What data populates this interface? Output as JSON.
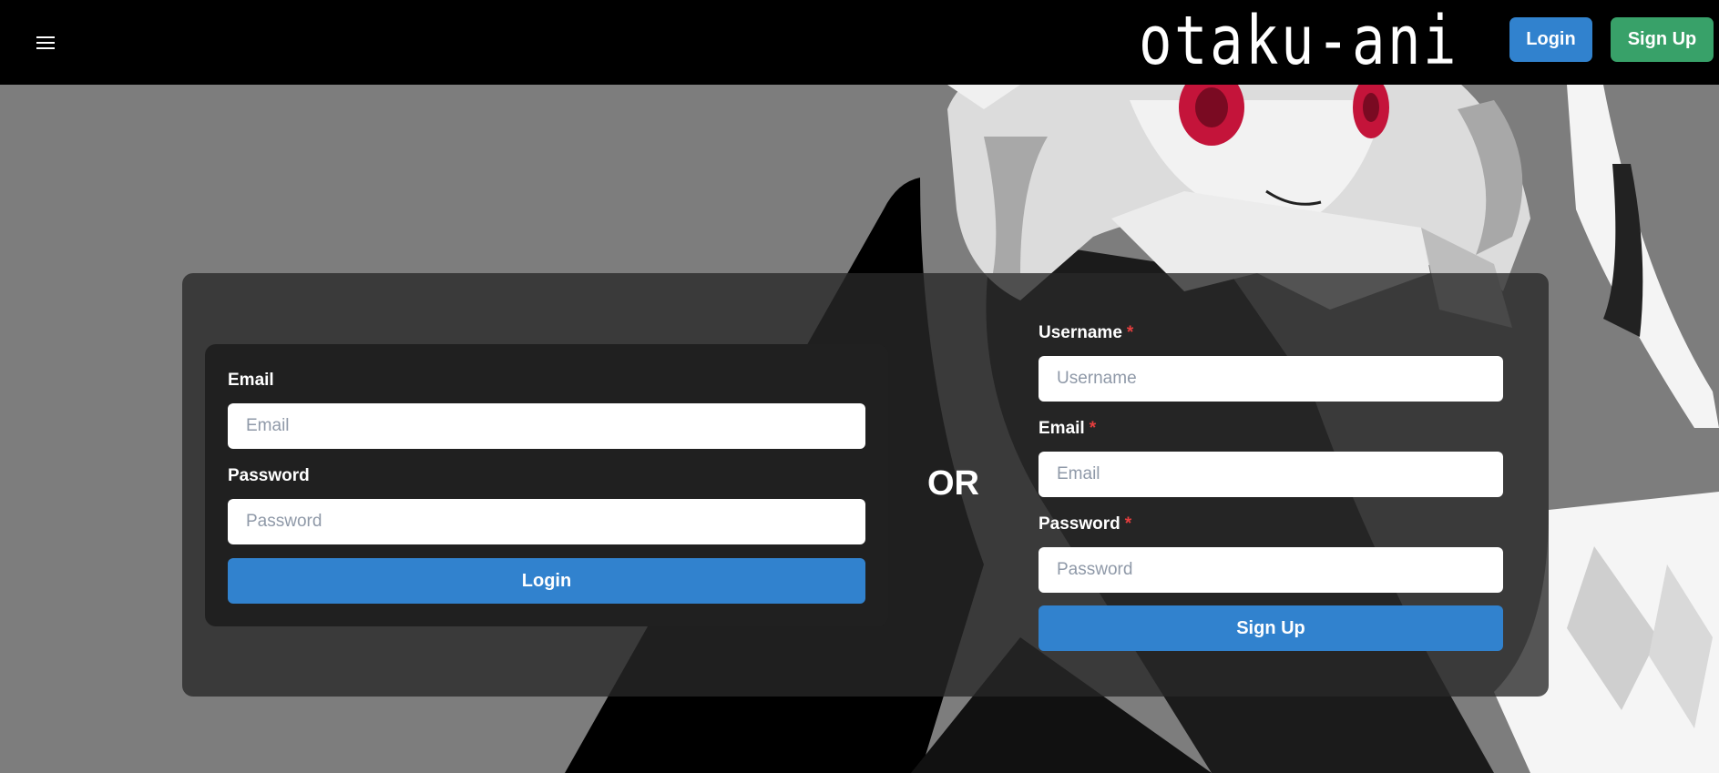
{
  "header": {
    "brand": "otaku-ani",
    "login_label": "Login",
    "signup_label": "Sign Up"
  },
  "login_form": {
    "email_label": "Email",
    "email_placeholder": "Email",
    "password_label": "Password",
    "password_placeholder": "Password",
    "submit_label": "Login"
  },
  "divider": {
    "text": "OR"
  },
  "signup_form": {
    "username_label": "Username",
    "username_placeholder": "Username",
    "email_label": "Email",
    "email_placeholder": "Email",
    "password_label": "Password",
    "password_placeholder": "Password",
    "required_mark": "*",
    "submit_label": "Sign Up"
  },
  "icons": {
    "menu": "hamburger-menu-icon"
  },
  "colors": {
    "nav_bg": "#000000",
    "page_bg": "#7d7d7d",
    "primary": "#3182ce",
    "success": "#38a169",
    "required": "#e53e3e"
  }
}
